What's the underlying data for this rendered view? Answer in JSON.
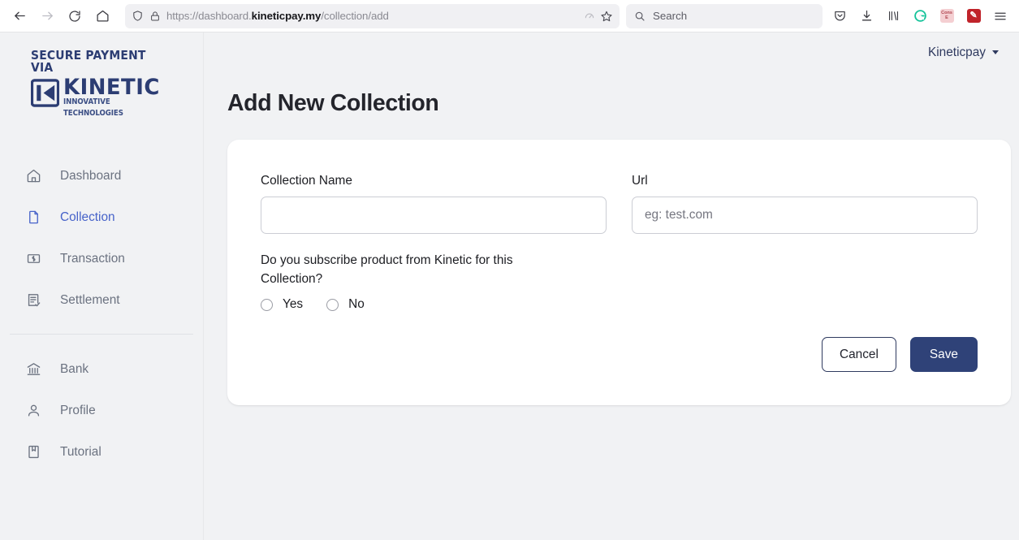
{
  "browser": {
    "back_icon": "arrow-left-icon",
    "forward_icon": "arrow-right-icon",
    "reload_icon": "reload-icon",
    "home_icon": "home-icon",
    "shield_icon": "shield-icon",
    "lock_icon": "lock-icon",
    "url_prefix": "https://dashboard.",
    "url_domain": "kineticpay.my",
    "url_suffix": "/collection/add",
    "reader_icon": "reader-mode-icon",
    "bookmark_icon": "star-icon",
    "search_placeholder": "Search",
    "search_icon": "search-icon",
    "pocket_icon": "pocket-icon",
    "downloads_icon": "download-icon",
    "library_icon": "library-icon",
    "grammarly_icon": "G",
    "ext_cons_label": "Cons E",
    "ext_wand_icon": "wand-icon",
    "menu_icon": "hamburger-menu-icon"
  },
  "sidebar": {
    "logo": {
      "tagline": "SECURE PAYMENT VIA",
      "brand": "KINETIC",
      "subtitle": "INNOVATIVE TECHNOLOGIES",
      "mark_color": "#2c3d73"
    },
    "items": [
      {
        "label": "Dashboard",
        "icon": "home-icon",
        "active": false
      },
      {
        "label": "Collection",
        "icon": "document-icon",
        "active": true
      },
      {
        "label": "Transaction",
        "icon": "money-icon",
        "active": false
      },
      {
        "label": "Settlement",
        "icon": "receipt-check-icon",
        "active": false
      }
    ],
    "items_secondary": [
      {
        "label": "Bank",
        "icon": "bank-icon",
        "active": false
      },
      {
        "label": "Profile",
        "icon": "user-icon",
        "active": false
      },
      {
        "label": "Tutorial",
        "icon": "book-icon",
        "active": false
      }
    ],
    "active_color": "#4763c9",
    "inactive_color": "#6b7280"
  },
  "topbar": {
    "user_name": "Kineticpay",
    "caret_icon": "chevron-down-icon"
  },
  "page": {
    "title": "Add New Collection"
  },
  "form": {
    "collection_name": {
      "label": "Collection Name",
      "value": "",
      "placeholder": ""
    },
    "url": {
      "label": "Url",
      "value": "",
      "placeholder": "eg: test.com"
    },
    "subscribe_question": "Do you subscribe product from Kinetic for this Collection?",
    "radio_options": [
      {
        "label": "Yes",
        "selected": false
      },
      {
        "label": "No",
        "selected": false
      }
    ],
    "cancel_label": "Cancel",
    "save_label": "Save",
    "save_color": "#2f4278"
  }
}
